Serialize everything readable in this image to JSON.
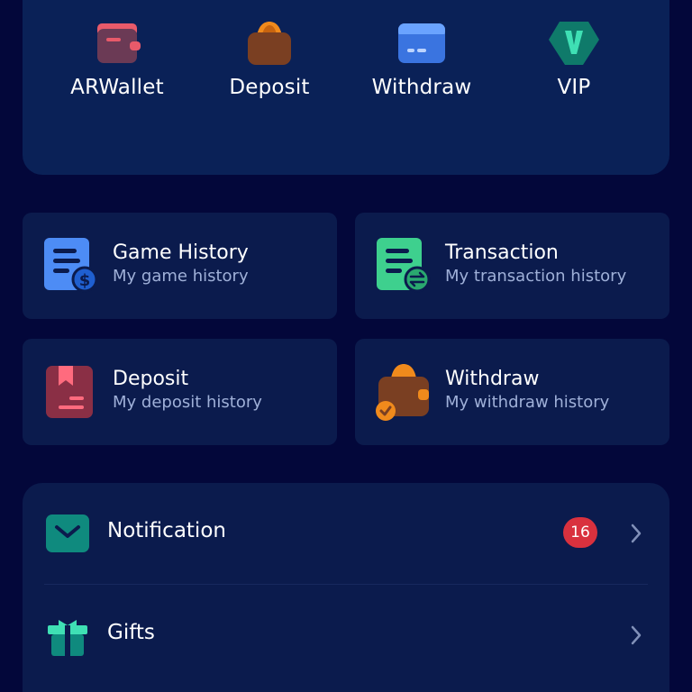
{
  "quick_actions": [
    {
      "label": "ARWallet",
      "icon": "wallet-icon"
    },
    {
      "label": "Deposit",
      "icon": "deposit-purse-icon"
    },
    {
      "label": "Withdraw",
      "icon": "card-icon"
    },
    {
      "label": "VIP",
      "icon": "vip-badge-icon"
    }
  ],
  "history_cards": [
    {
      "title": "Game History",
      "subtitle": "My game history",
      "icon": "game-history-icon"
    },
    {
      "title": "Transaction",
      "subtitle": "My transaction history",
      "icon": "transaction-icon"
    },
    {
      "title": "Deposit",
      "subtitle": "My deposit history",
      "icon": "deposit-history-icon"
    },
    {
      "title": "Withdraw",
      "subtitle": "My withdraw history",
      "icon": "withdraw-history-icon"
    }
  ],
  "list": {
    "notification": {
      "label": "Notification",
      "badge": "16"
    },
    "gifts": {
      "label": "Gifts"
    }
  },
  "colors": {
    "background": "#03073a",
    "top_card": "#0a2157",
    "card": "#0b1b4d",
    "badge": "#d9313e"
  }
}
